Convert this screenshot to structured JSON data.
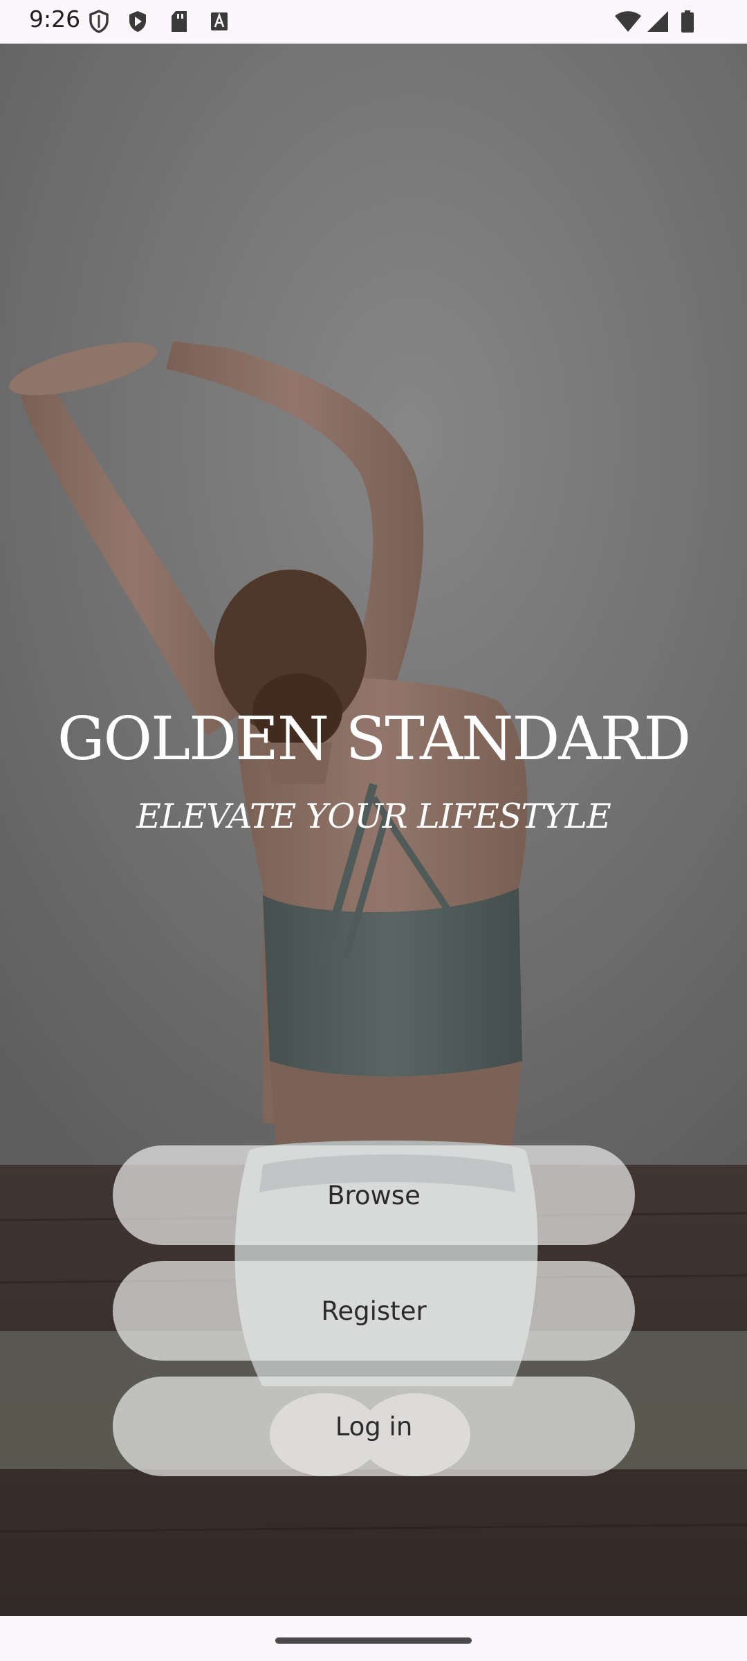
{
  "status_bar": {
    "time": "9:26",
    "left_icons": [
      "shield-icon",
      "play-protect-icon",
      "sd-card-icon",
      "keyboard-a-icon"
    ],
    "right_icons": [
      "wifi-icon",
      "cell-signal-icon",
      "battery-icon"
    ]
  },
  "brand": {
    "title": "GOLDEN STANDARD",
    "tagline": "ELEVATE YOUR LIFESTYLE"
  },
  "actions": {
    "browse_label": "Browse",
    "register_label": "Register",
    "login_label": "Log in"
  },
  "colors": {
    "status_bar_bg": "#fbf7fb",
    "button_bg": "#e8e8e8",
    "button_text": "#2b2b2b",
    "brand_text": "#ffffff"
  }
}
